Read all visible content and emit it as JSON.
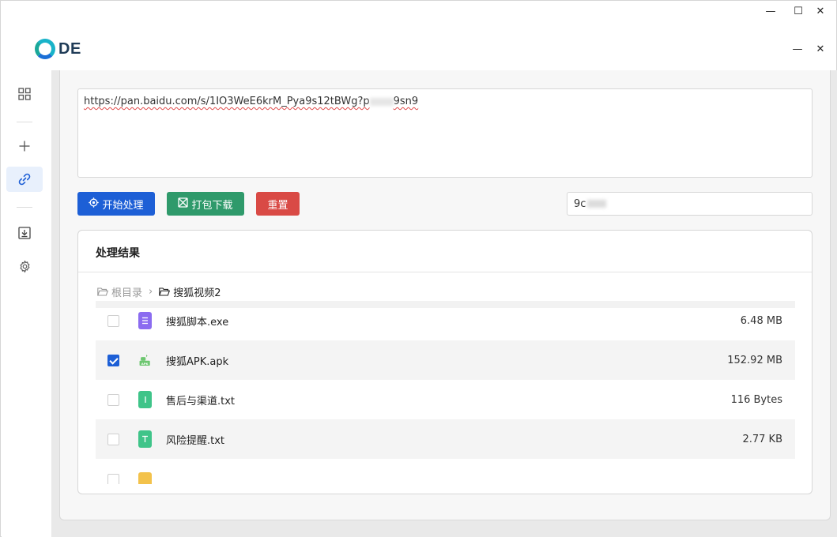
{
  "window": {
    "minimize_glyph": "—",
    "maximize_glyph": "☐",
    "close_glyph": "✕"
  },
  "app_controls": {
    "minimize_glyph": "—",
    "close_glyph": "✕"
  },
  "logo": {
    "text": "DE"
  },
  "sidebar": {
    "items": [
      {
        "icon": "grid-icon",
        "active": false
      },
      {
        "icon": "plus-icon",
        "active": false
      },
      {
        "icon": "link-icon",
        "active": true
      },
      {
        "icon": "download-icon",
        "active": false
      },
      {
        "icon": "gear-icon",
        "active": false
      }
    ]
  },
  "url_input": {
    "value": "https://pan.baidu.com/s/1IO3WeE6krM_Pya9s12tBWg?p",
    "value_tail": "9sn9"
  },
  "toolbar": {
    "start_label": "开始处理",
    "download_label": "打包下载",
    "reset_label": "重置",
    "accent_blue": "#1d5fd6",
    "accent_green": "#2f9a6b",
    "accent_red": "#d94a45"
  },
  "code_input": {
    "value": "9c"
  },
  "result": {
    "title": "处理结果",
    "breadcrumb": {
      "root": "根目录",
      "separator": "›",
      "current": "搜狐视频2"
    },
    "files": [
      {
        "name": "搜狐脚本.exe",
        "size": "6.48 MB",
        "checked": false,
        "icon": "document-icon",
        "color": "#8b6cf0"
      },
      {
        "name": "搜狐APK.apk",
        "size": "152.92 MB",
        "checked": true,
        "icon": "android-icon",
        "color": "#6cc66f"
      },
      {
        "name": "售后与渠道.txt",
        "size": "116 Bytes",
        "checked": false,
        "icon": "text-file-icon",
        "color": "#3fc489"
      },
      {
        "name": "风险提醒.txt",
        "size": "2.77 KB",
        "checked": false,
        "icon": "text-file-icon",
        "color": "#3fc489"
      }
    ]
  }
}
